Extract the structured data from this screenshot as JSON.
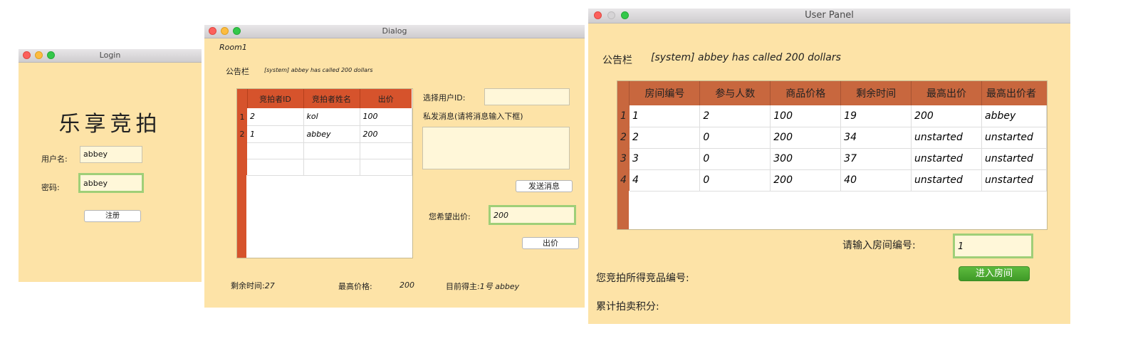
{
  "login": {
    "title": "Login",
    "heading": "乐享竞拍",
    "username_label": "用户名:",
    "username_value": "abbey",
    "password_label": "密码:",
    "password_value": "abbey",
    "register_button": "注册"
  },
  "dialog": {
    "title": "Dialog",
    "room_label": "Room1",
    "notice_label": "公告栏",
    "notice_text": "[system] abbey has called 200 dollars",
    "table": {
      "headers": [
        "竞拍者ID",
        "竞拍者姓名",
        "出价"
      ],
      "rows": [
        {
          "num": "1",
          "cells": [
            "2",
            "kol",
            "100"
          ]
        },
        {
          "num": "2",
          "cells": [
            "1",
            "abbey",
            "200"
          ]
        }
      ]
    },
    "select_user_label": "选择用户ID:",
    "private_msg_label": "私发消息(请将消息输入下框)",
    "send_button": "发送消息",
    "bid_label": "您希望出价:",
    "bid_value": "200",
    "bid_button": "出价",
    "remaining_label": "剩余时间:",
    "remaining_value": "27",
    "max_price_label": "最高价格:",
    "max_price_value": "200",
    "current_owner_label": "目前得主:",
    "current_owner_value": "1号 abbey"
  },
  "user_panel": {
    "title": "User Panel",
    "notice_label": "公告栏",
    "notice_text": "[system] abbey has called 200 dollars",
    "table": {
      "headers": [
        "房间编号",
        "参与人数",
        "商品价格",
        "剩余时间",
        "最高出价",
        "最高出价者"
      ],
      "rows": [
        {
          "num": "1",
          "cells": [
            "1",
            "2",
            "100",
            "19",
            "200",
            "abbey"
          ]
        },
        {
          "num": "2",
          "cells": [
            "2",
            "0",
            "200",
            "34",
            "unstarted",
            "unstarted"
          ]
        },
        {
          "num": "3",
          "cells": [
            "3",
            "0",
            "300",
            "37",
            "unstarted",
            "unstarted"
          ]
        },
        {
          "num": "4",
          "cells": [
            "4",
            "0",
            "200",
            "40",
            "unstarted",
            "unstarted"
          ]
        }
      ]
    },
    "room_input_label": "请输入房间编号:",
    "room_input_value": "1",
    "enter_button": "进入房间",
    "won_items_label": "您竞拍所得竞品编号:",
    "score_label": "累计拍卖积分:"
  },
  "colors": {
    "window_bg": "#fde3a7",
    "dialog_table_header": "#d6532c",
    "panel_table_header": "#c8673e",
    "enter_button": "#4caf33"
  }
}
